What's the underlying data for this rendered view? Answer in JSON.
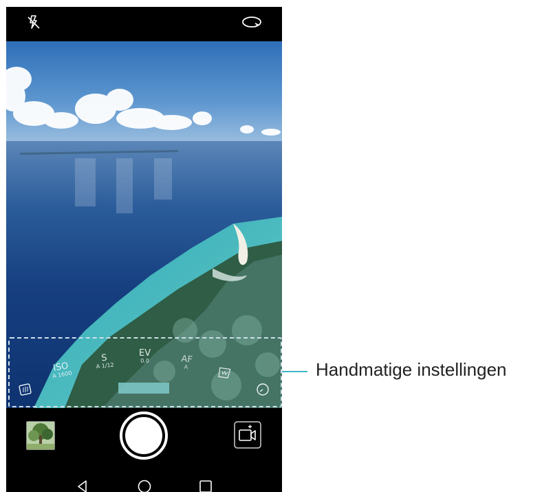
{
  "camera": {
    "controls": {
      "iso": {
        "label": "ISO",
        "value": "A 1600"
      },
      "shutter": {
        "label": "S",
        "value": "A 1/12"
      },
      "ev": {
        "label": "EV",
        "value": "0.0"
      },
      "af": {
        "label": "AF",
        "value": "A"
      },
      "wb": {
        "label": "WB",
        "value": ""
      }
    }
  },
  "callout": {
    "label": "Handmatige instellingen"
  },
  "colors": {
    "accent": "#3bb7c8",
    "dashed_border": "#cfe0ea"
  },
  "icons": [
    "flash-off-icon",
    "switch-camera-icon",
    "gallery-thumbnail",
    "shutter-button",
    "video-mode-icon",
    "back-icon",
    "home-icon",
    "recent-apps-icon",
    "mode-icon",
    "timer-icon"
  ]
}
